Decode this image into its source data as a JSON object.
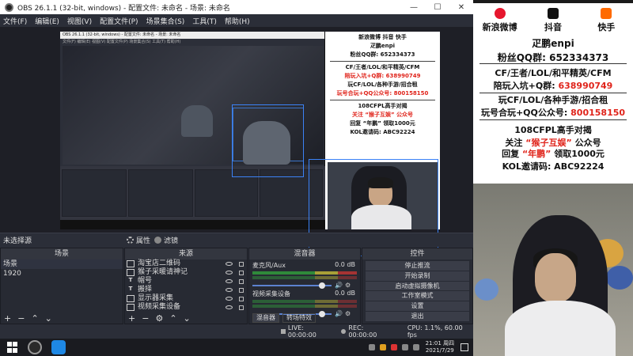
{
  "window": {
    "title": "OBS 26.1.1 (32-bit, windows) - 配置文件: 未命名 - 场景: 未命名",
    "controls": [
      "—",
      "☐",
      "✕"
    ]
  },
  "menu": [
    "文件(F)",
    "编辑(E)",
    "视图(V)",
    "配置文件(P)",
    "场景集合(S)",
    "工具(T)",
    "帮助(H)"
  ],
  "nested": {
    "title": "OBS 26.1.1 (32-bit, windows) - 配置文件: 未命名 - 场景: 未命名",
    "menu": "文件(F)  编辑(E)  视图(V)  配置文件(P)  场景集合(S)  工具(T)  帮助(H)"
  },
  "no_scene_label": "未选择源",
  "properties_label": "属性",
  "filters_label": "滤镜",
  "scenes": {
    "header": "场景",
    "items": [
      {
        "label": "场景",
        "selected": true
      },
      {
        "label": "1920",
        "selected": false
      }
    ]
  },
  "sources": {
    "header": "来源",
    "items": [
      {
        "label": "淘宝店二维码",
        "icon": "image-icon"
      },
      {
        "label": "猴子采暖请神记",
        "icon": "image-icon"
      },
      {
        "label": "帽号",
        "icon": "text-icon"
      },
      {
        "label": "搬择",
        "icon": "text-icon"
      },
      {
        "label": "显示器采集",
        "icon": "monitor-icon"
      },
      {
        "label": "视频采集设备",
        "icon": "camera-icon"
      }
    ]
  },
  "mixer": {
    "header": "混音器",
    "channels": [
      {
        "name": "麦克风/Aux",
        "db": "0.0 dB"
      },
      {
        "name": "视频采集设备",
        "db": "0.0 dB"
      }
    ],
    "tabs": [
      "混音器",
      "转场特效"
    ]
  },
  "controls": {
    "header": "控件",
    "buttons": [
      "停止推流",
      "开始录制",
      "启动虚拟摄像机",
      "工作室模式",
      "设置",
      "退出"
    ]
  },
  "statusbar": {
    "live": "LIVE: 00:00:00",
    "rec": "REC: 00:00:00",
    "cpu": "CPU: 1.1%, 60.00 fps"
  },
  "overlay": {
    "social": [
      {
        "label": "新浪微博",
        "color": "#e6162d",
        "icon": "weibo-icon"
      },
      {
        "label": "抖音",
        "color": "#111111",
        "icon": "douyin-icon"
      },
      {
        "label": "快手",
        "color": "#ff6a00",
        "icon": "kuaishou-icon"
      }
    ],
    "lines": {
      "name": "疋鹏enpi",
      "qq_fans_prefix": "粉丝QQ群:",
      "qq_fans": "652334373",
      "games": "CF/王者/LOL/和平精英/CFM",
      "group_prefix": "陪玩入坑+Q群:",
      "group": "638990749",
      "play_prefix": "玩CF/LOL/各种手游/招合租",
      "account_prefix": "玩号合玩+QQ公众号:",
      "account": "800158150",
      "match": "108CFPL高手对揭",
      "follow_a": "关注",
      "follow_b": "“猴子互娱”",
      "follow_c": "公众号",
      "reply_a": "回复",
      "reply_b": "“年鹏”",
      "reply_c": "领取1000元",
      "invite": "KOL邀请码: ABC92224"
    },
    "poster": [
      "新浪微博   抖音   快手",
      "疋鹏enpi",
      "粉丝QQ群: 652334373",
      "CF/王者/LOL/和平精英/CFM",
      "陪玩入坑+Q群: 638990749",
      "玩CF/LOL/各种手游/招合租",
      "玩号合玩+QQ公众号: 800158150",
      "108CFPL高手对揭",
      "关注 “猴子互娱” 公众号",
      "回复 “年鹏” 领取1000元",
      "KOL邀请码: ABC92224"
    ]
  },
  "taskbar": {
    "time": "21:01 周四",
    "date": "2021/7/29"
  },
  "colors": {
    "accent_blue": "#3b82f6",
    "red_text": "#e0241b",
    "obs_bg": "#2b2e38"
  }
}
